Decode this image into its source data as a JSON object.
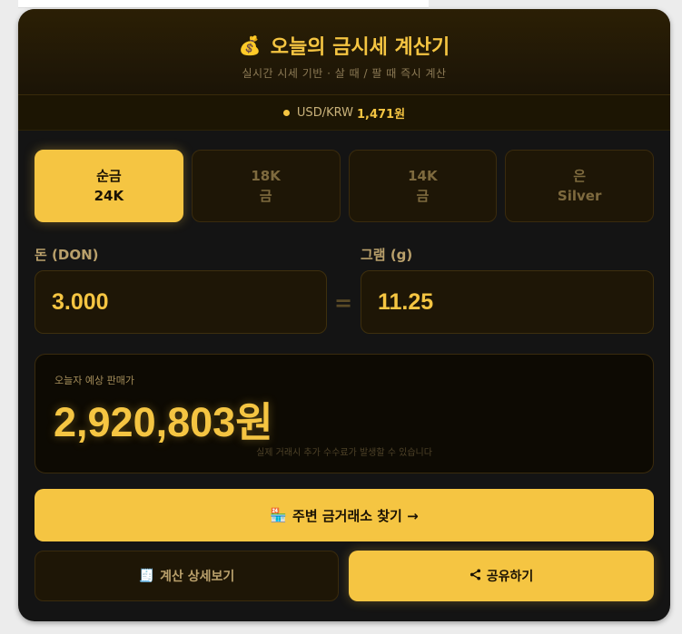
{
  "header": {
    "icon": "money-bag-icon",
    "icon_glyph": "💰",
    "title": "오늘의 금시세 계산기",
    "subtitle": "실시간 시세 기반 · 살 때 / 팔 때 즉시 계산"
  },
  "rate": {
    "label": "USD/KRW",
    "value": "1,471원"
  },
  "tabs": [
    {
      "line1": "순금",
      "line2": "24K",
      "active": true
    },
    {
      "line1": "18K",
      "line2": "금",
      "active": false
    },
    {
      "line1": "14K",
      "line2": "금",
      "active": false
    },
    {
      "line1": "은",
      "line2": "Silver",
      "active": false
    }
  ],
  "inputs": {
    "don_label": "돈 (DON)",
    "don_value": "3.000",
    "equals": "=",
    "gram_label": "그램 (g)",
    "gram_value": "11.25"
  },
  "result": {
    "label": "오늘자 예상 판매가",
    "price": "2,920,803원",
    "note": "실제 거래시 추가 수수료가 발생할 수 있습니다"
  },
  "buttons": {
    "find_store_icon": "🏪",
    "find_store_label": "주변 금거래소 찾기 →",
    "detail_icon": "🧾",
    "detail_label": "계산 상세보기",
    "share_label": "공유하기"
  },
  "colors": {
    "accent": "#f5c542",
    "background": "#141414"
  }
}
